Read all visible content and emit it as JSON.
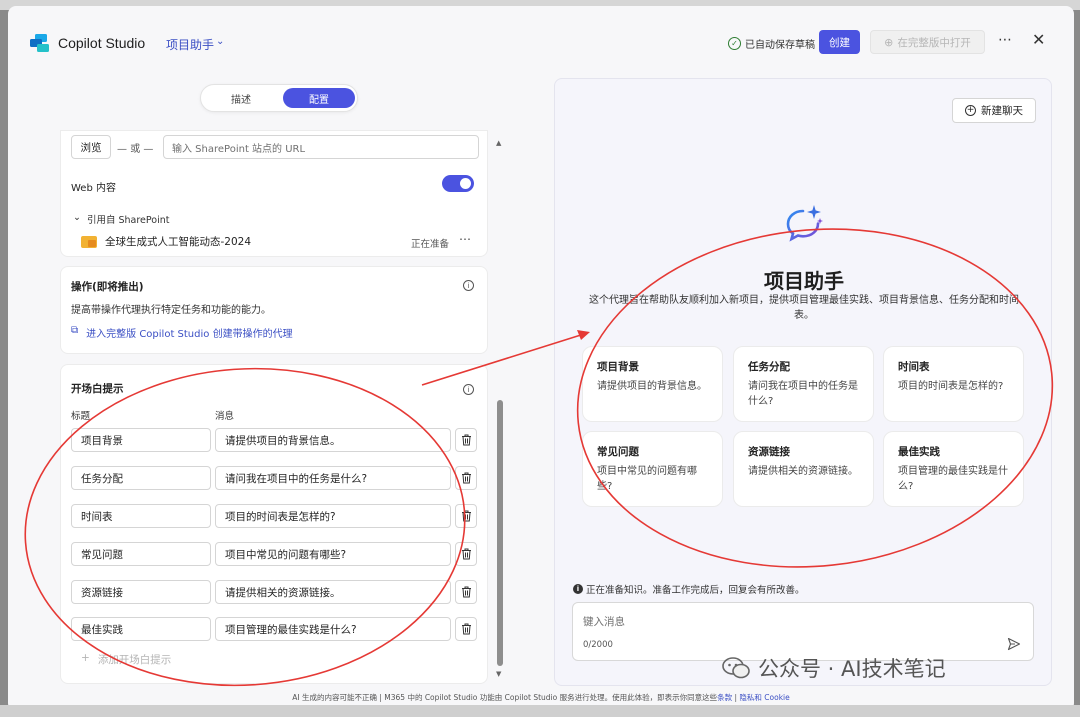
{
  "header": {
    "app_title": "Copilot Studio",
    "agent_name": "项目助手",
    "saved_status": "已自动保存草稿",
    "create_label": "创建",
    "open_full_label": "在完整版中打开"
  },
  "tabs": [
    {
      "label": "描述",
      "active": false
    },
    {
      "label": "配置",
      "active": true
    }
  ],
  "knowledge": {
    "browse_label": "浏览",
    "or_label": "或",
    "url_placeholder": "输入 SharePoint 站点的 URL",
    "web_content_label": "Web 内容",
    "web_content_enabled": true,
    "sharepoint_section": "引用自 SharePoint",
    "file_name": "全球生成式人工智能动态-2024",
    "file_status": "正在准备"
  },
  "actions": {
    "title": "操作(即将推出)",
    "description": "提高带操作代理执行特定任务和功能的能力。",
    "link": "进入完整版 Copilot Studio 创建带操作的代理"
  },
  "starter_prompts": {
    "title": "开场白提示",
    "col_title": "标题",
    "col_message": "消息",
    "rows": [
      {
        "title": "项目背景",
        "message": "请提供项目的背景信息。"
      },
      {
        "title": "任务分配",
        "message": "请问我在项目中的任务是什么?"
      },
      {
        "title": "时间表",
        "message": "项目的时间表是怎样的?"
      },
      {
        "title": "常见问题",
        "message": "项目中常见的问题有哪些?"
      },
      {
        "title": "资源链接",
        "message": "请提供相关的资源链接。"
      },
      {
        "title": "最佳实践",
        "message": "项目管理的最佳实践是什么?"
      }
    ],
    "add_label": "添加开场白提示"
  },
  "preview": {
    "new_chat_label": "新建聊天",
    "agent_title": "项目助手",
    "agent_description": "这个代理旨在帮助队友顺利加入新项目，提供项目管理最佳实践、项目背景信息、任务分配和时间表。",
    "cards": [
      {
        "title": "项目背景",
        "message": "请提供项目的背景信息。"
      },
      {
        "title": "任务分配",
        "message": "请问我在项目中的任务是什么?"
      },
      {
        "title": "时间表",
        "message": "项目的时间表是怎样的?"
      },
      {
        "title": "常见问题",
        "message": "项目中常见的问题有哪些?"
      },
      {
        "title": "资源链接",
        "message": "请提供相关的资源链接。"
      },
      {
        "title": "最佳实践",
        "message": "项目管理的最佳实践是什么?"
      }
    ],
    "notice": "正在准备知识。准备工作完成后，回复会有所改善。",
    "input_placeholder": "键入消息",
    "char_count": "0/2000"
  },
  "footer": {
    "text": "AI 生成的内容可能不正确 | M365 中的 Copilot Studio 功能由 Copilot Studio 服务进行处理。使用此体验，即表示你同意这些",
    "terms_link": "条款",
    "separator": " | ",
    "privacy_link": "隐私和 Cookie"
  },
  "watermark": "公众号 · AI技术笔记",
  "colors": {
    "accent": "#4b53e0",
    "link": "#3b4fc4",
    "annotation": "#e53935"
  }
}
